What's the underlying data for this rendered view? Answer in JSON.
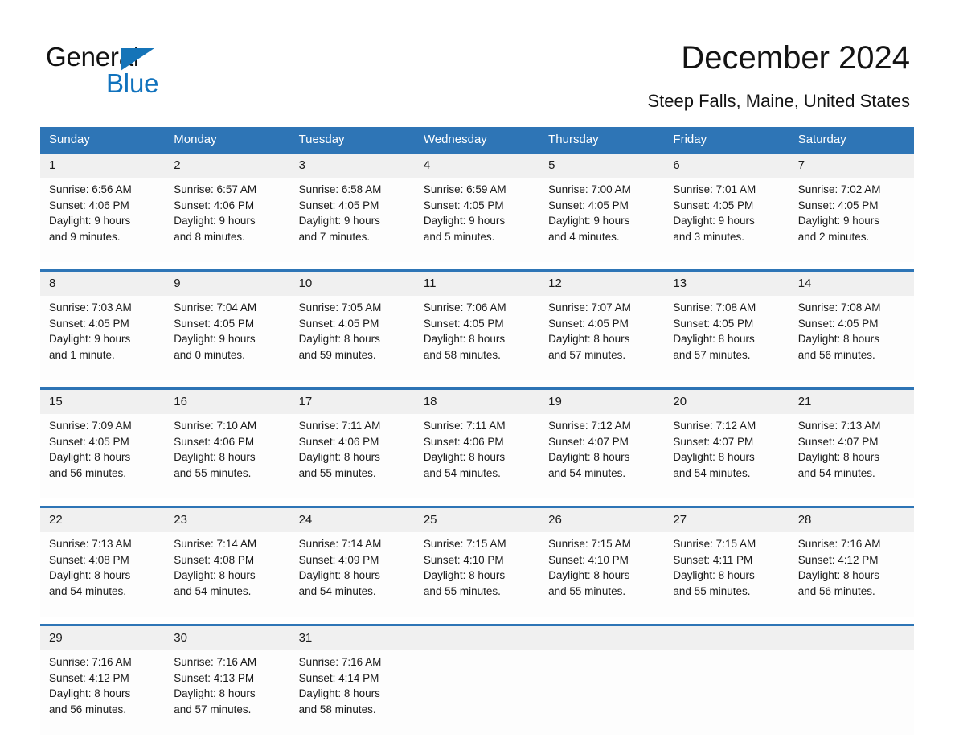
{
  "brand": {
    "name_part1": "General",
    "name_part2": "Blue",
    "triangle_icon": "triangle-icon",
    "color_primary": "#1072bd",
    "color_dark": "#111111"
  },
  "header": {
    "title": "December 2024",
    "location": "Steep Falls, Maine, United States"
  },
  "theme": {
    "header_blue": "#2e75b6",
    "daynum_gray": "#f0f0f0",
    "cell_white": "#fdfdfd",
    "text": "#1a1a1a"
  },
  "calendar": {
    "weekday_headers": [
      "Sunday",
      "Monday",
      "Tuesday",
      "Wednesday",
      "Thursday",
      "Friday",
      "Saturday"
    ],
    "weeks": [
      [
        {
          "day": "1",
          "sunrise": "Sunrise: 6:56 AM",
          "sunset": "Sunset: 4:06 PM",
          "daylight_line1": "Daylight: 9 hours",
          "daylight_line2": "and 9 minutes."
        },
        {
          "day": "2",
          "sunrise": "Sunrise: 6:57 AM",
          "sunset": "Sunset: 4:06 PM",
          "daylight_line1": "Daylight: 9 hours",
          "daylight_line2": "and 8 minutes."
        },
        {
          "day": "3",
          "sunrise": "Sunrise: 6:58 AM",
          "sunset": "Sunset: 4:05 PM",
          "daylight_line1": "Daylight: 9 hours",
          "daylight_line2": "and 7 minutes."
        },
        {
          "day": "4",
          "sunrise": "Sunrise: 6:59 AM",
          "sunset": "Sunset: 4:05 PM",
          "daylight_line1": "Daylight: 9 hours",
          "daylight_line2": "and 5 minutes."
        },
        {
          "day": "5",
          "sunrise": "Sunrise: 7:00 AM",
          "sunset": "Sunset: 4:05 PM",
          "daylight_line1": "Daylight: 9 hours",
          "daylight_line2": "and 4 minutes."
        },
        {
          "day": "6",
          "sunrise": "Sunrise: 7:01 AM",
          "sunset": "Sunset: 4:05 PM",
          "daylight_line1": "Daylight: 9 hours",
          "daylight_line2": "and 3 minutes."
        },
        {
          "day": "7",
          "sunrise": "Sunrise: 7:02 AM",
          "sunset": "Sunset: 4:05 PM",
          "daylight_line1": "Daylight: 9 hours",
          "daylight_line2": "and 2 minutes."
        }
      ],
      [
        {
          "day": "8",
          "sunrise": "Sunrise: 7:03 AM",
          "sunset": "Sunset: 4:05 PM",
          "daylight_line1": "Daylight: 9 hours",
          "daylight_line2": "and 1 minute."
        },
        {
          "day": "9",
          "sunrise": "Sunrise: 7:04 AM",
          "sunset": "Sunset: 4:05 PM",
          "daylight_line1": "Daylight: 9 hours",
          "daylight_line2": "and 0 minutes."
        },
        {
          "day": "10",
          "sunrise": "Sunrise: 7:05 AM",
          "sunset": "Sunset: 4:05 PM",
          "daylight_line1": "Daylight: 8 hours",
          "daylight_line2": "and 59 minutes."
        },
        {
          "day": "11",
          "sunrise": "Sunrise: 7:06 AM",
          "sunset": "Sunset: 4:05 PM",
          "daylight_line1": "Daylight: 8 hours",
          "daylight_line2": "and 58 minutes."
        },
        {
          "day": "12",
          "sunrise": "Sunrise: 7:07 AM",
          "sunset": "Sunset: 4:05 PM",
          "daylight_line1": "Daylight: 8 hours",
          "daylight_line2": "and 57 minutes."
        },
        {
          "day": "13",
          "sunrise": "Sunrise: 7:08 AM",
          "sunset": "Sunset: 4:05 PM",
          "daylight_line1": "Daylight: 8 hours",
          "daylight_line2": "and 57 minutes."
        },
        {
          "day": "14",
          "sunrise": "Sunrise: 7:08 AM",
          "sunset": "Sunset: 4:05 PM",
          "daylight_line1": "Daylight: 8 hours",
          "daylight_line2": "and 56 minutes."
        }
      ],
      [
        {
          "day": "15",
          "sunrise": "Sunrise: 7:09 AM",
          "sunset": "Sunset: 4:05 PM",
          "daylight_line1": "Daylight: 8 hours",
          "daylight_line2": "and 56 minutes."
        },
        {
          "day": "16",
          "sunrise": "Sunrise: 7:10 AM",
          "sunset": "Sunset: 4:06 PM",
          "daylight_line1": "Daylight: 8 hours",
          "daylight_line2": "and 55 minutes."
        },
        {
          "day": "17",
          "sunrise": "Sunrise: 7:11 AM",
          "sunset": "Sunset: 4:06 PM",
          "daylight_line1": "Daylight: 8 hours",
          "daylight_line2": "and 55 minutes."
        },
        {
          "day": "18",
          "sunrise": "Sunrise: 7:11 AM",
          "sunset": "Sunset: 4:06 PM",
          "daylight_line1": "Daylight: 8 hours",
          "daylight_line2": "and 54 minutes."
        },
        {
          "day": "19",
          "sunrise": "Sunrise: 7:12 AM",
          "sunset": "Sunset: 4:07 PM",
          "daylight_line1": "Daylight: 8 hours",
          "daylight_line2": "and 54 minutes."
        },
        {
          "day": "20",
          "sunrise": "Sunrise: 7:12 AM",
          "sunset": "Sunset: 4:07 PM",
          "daylight_line1": "Daylight: 8 hours",
          "daylight_line2": "and 54 minutes."
        },
        {
          "day": "21",
          "sunrise": "Sunrise: 7:13 AM",
          "sunset": "Sunset: 4:07 PM",
          "daylight_line1": "Daylight: 8 hours",
          "daylight_line2": "and 54 minutes."
        }
      ],
      [
        {
          "day": "22",
          "sunrise": "Sunrise: 7:13 AM",
          "sunset": "Sunset: 4:08 PM",
          "daylight_line1": "Daylight: 8 hours",
          "daylight_line2": "and 54 minutes."
        },
        {
          "day": "23",
          "sunrise": "Sunrise: 7:14 AM",
          "sunset": "Sunset: 4:08 PM",
          "daylight_line1": "Daylight: 8 hours",
          "daylight_line2": "and 54 minutes."
        },
        {
          "day": "24",
          "sunrise": "Sunrise: 7:14 AM",
          "sunset": "Sunset: 4:09 PM",
          "daylight_line1": "Daylight: 8 hours",
          "daylight_line2": "and 54 minutes."
        },
        {
          "day": "25",
          "sunrise": "Sunrise: 7:15 AM",
          "sunset": "Sunset: 4:10 PM",
          "daylight_line1": "Daylight: 8 hours",
          "daylight_line2": "and 55 minutes."
        },
        {
          "day": "26",
          "sunrise": "Sunrise: 7:15 AM",
          "sunset": "Sunset: 4:10 PM",
          "daylight_line1": "Daylight: 8 hours",
          "daylight_line2": "and 55 minutes."
        },
        {
          "day": "27",
          "sunrise": "Sunrise: 7:15 AM",
          "sunset": "Sunset: 4:11 PM",
          "daylight_line1": "Daylight: 8 hours",
          "daylight_line2": "and 55 minutes."
        },
        {
          "day": "28",
          "sunrise": "Sunrise: 7:16 AM",
          "sunset": "Sunset: 4:12 PM",
          "daylight_line1": "Daylight: 8 hours",
          "daylight_line2": "and 56 minutes."
        }
      ],
      [
        {
          "day": "29",
          "sunrise": "Sunrise: 7:16 AM",
          "sunset": "Sunset: 4:12 PM",
          "daylight_line1": "Daylight: 8 hours",
          "daylight_line2": "and 56 minutes."
        },
        {
          "day": "30",
          "sunrise": "Sunrise: 7:16 AM",
          "sunset": "Sunset: 4:13 PM",
          "daylight_line1": "Daylight: 8 hours",
          "daylight_line2": "and 57 minutes."
        },
        {
          "day": "31",
          "sunrise": "Sunrise: 7:16 AM",
          "sunset": "Sunset: 4:14 PM",
          "daylight_line1": "Daylight: 8 hours",
          "daylight_line2": "and 58 minutes."
        },
        {
          "day": "",
          "sunrise": "",
          "sunset": "",
          "daylight_line1": "",
          "daylight_line2": ""
        },
        {
          "day": "",
          "sunrise": "",
          "sunset": "",
          "daylight_line1": "",
          "daylight_line2": ""
        },
        {
          "day": "",
          "sunrise": "",
          "sunset": "",
          "daylight_line1": "",
          "daylight_line2": ""
        },
        {
          "day": "",
          "sunrise": "",
          "sunset": "",
          "daylight_line1": "",
          "daylight_line2": ""
        }
      ]
    ]
  }
}
